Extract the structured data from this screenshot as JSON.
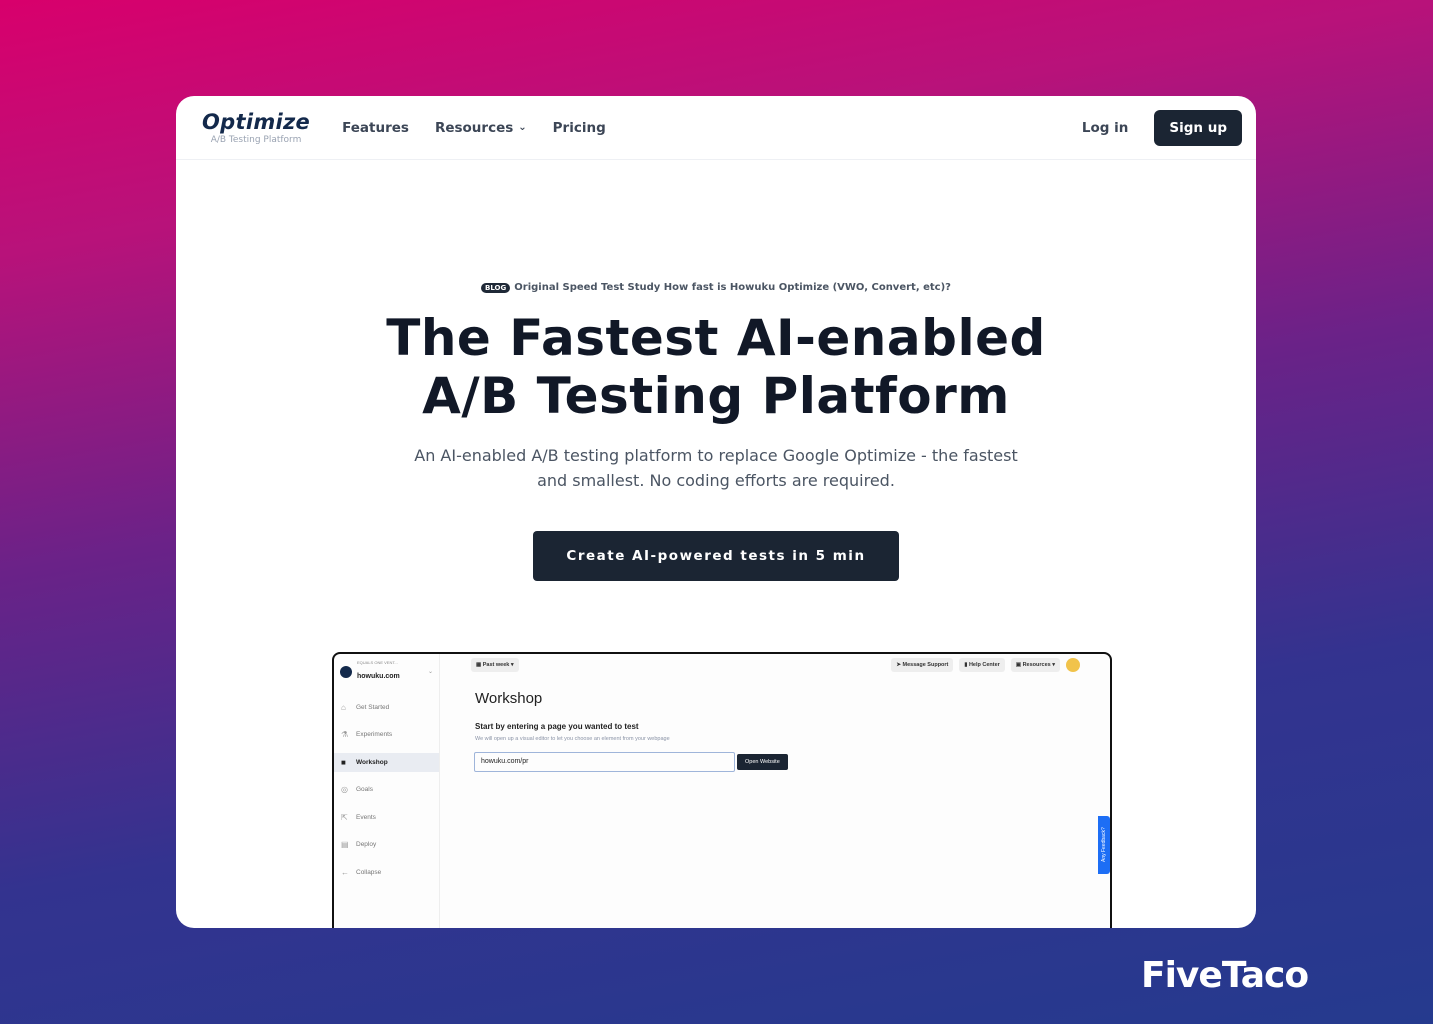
{
  "nav": {
    "logo": "Optimize",
    "logo_sub": "A/B Testing Platform",
    "links": [
      "Features",
      "Resources",
      "Pricing"
    ],
    "login": "Log in",
    "signup": "Sign up"
  },
  "hero": {
    "badge": "BLOG",
    "blog_text": "Original Speed Test Study How fast is Howuku Optimize (VWO, Convert, etc)?",
    "title_line1": "The Fastest AI-enabled",
    "title_line2": "A/B Testing Platform",
    "sub_line1": "An AI-enabled A/B testing platform to replace Google Optimize - the fastest",
    "sub_line2": "and smallest. No coding efforts are required.",
    "cta": "Create AI-powered tests in 5 min"
  },
  "app": {
    "workspace_org": "EQUALS ONE VENT...",
    "workspace": "howuku.com",
    "sidebar": [
      "Get Started",
      "Experiments",
      "Workshop",
      "Goals",
      "Events",
      "Deploy",
      "Collapse"
    ],
    "date_filter": "Past week",
    "message_support": "Message Support",
    "help_center": "Help Center",
    "resources": "Resources",
    "title": "Workshop",
    "heading": "Start by entering a page you wanted to test",
    "desc": "We will open up a visual editor to let you choose an element from your webpage",
    "url_value": "howuku.com/pr",
    "open_button": "Open Website",
    "feedback": "Any Feedback?"
  },
  "brand": "FiveTaco"
}
